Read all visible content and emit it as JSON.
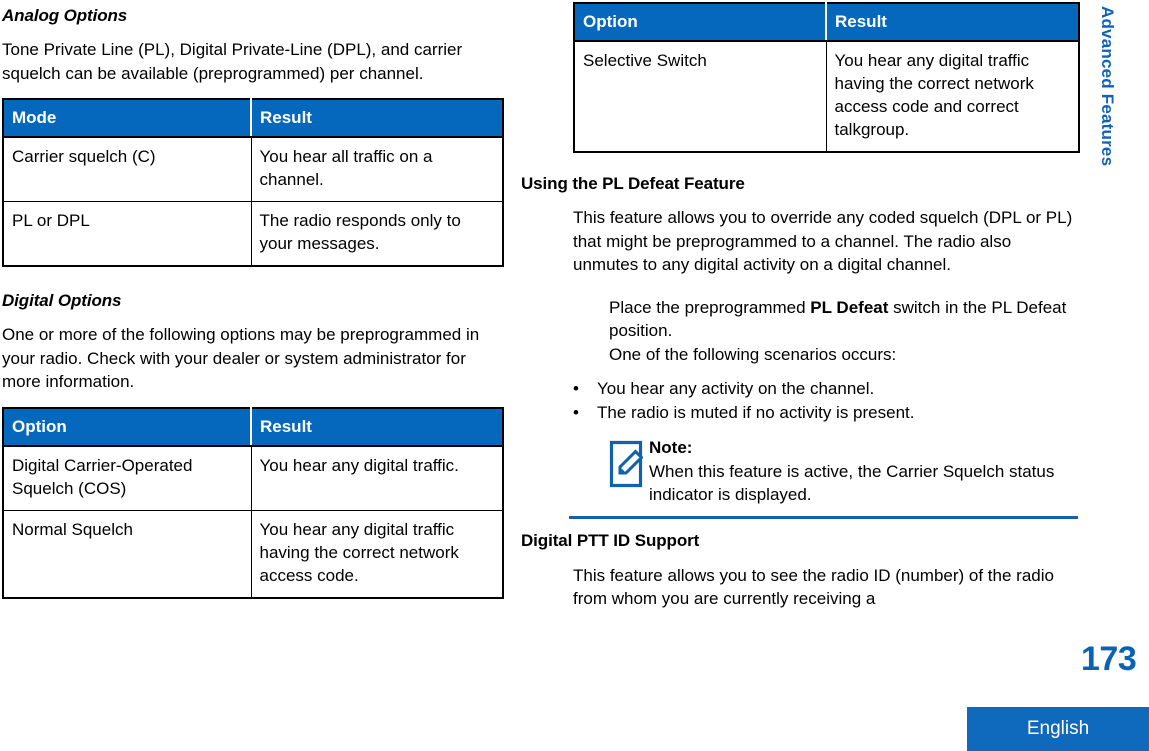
{
  "document": {
    "side_tab_label": "Advanced Features",
    "page_number": "173",
    "language_tab": "English",
    "accent_blue": "#0668bd",
    "rule_blue": "#0f62ab",
    "page_number_color": "#0a62b3"
  },
  "left_column": {
    "analog": {
      "heading": "Analog Options",
      "paragraph": "Tone Private Line (PL), Digital Private-Line (DPL), and carrier squelch can be available (preprogrammed) per channel.",
      "table": {
        "headers": [
          "Mode",
          "Result"
        ],
        "rows": [
          [
            "Carrier squelch (C)",
            "You hear all traffic on a channel."
          ],
          [
            "PL or DPL",
            "The radio responds only to your messages."
          ]
        ]
      }
    },
    "digital": {
      "heading": "Digital Options",
      "paragraph": "One or more of the following options may be preprogrammed in your radio. Check with your dealer or system administrator for more information.",
      "table": {
        "headers": [
          "Option",
          "Result"
        ],
        "rows": [
          [
            "Digital Carrier-Operated Squelch (COS)",
            "You hear any digital traffic."
          ],
          [
            "Normal Squelch",
            "You hear any digital traffic having the correct network access code."
          ]
        ]
      }
    }
  },
  "right_column": {
    "continued_table": {
      "headers": [
        "Option",
        "Result"
      ],
      "rows": [
        [
          "Selective Switch",
          "You hear any digital traffic having the correct network access code and correct talkgroup."
        ]
      ]
    },
    "pl_defeat": {
      "heading": "Using the PL Defeat Feature",
      "paragraph": "This feature allows you to override any coded squelch (DPL or PL) that might be preprogrammed to a channel. The radio also unmutes to any digital activity on a digital channel.",
      "step_prefix": "Place the preprogrammed ",
      "step_bold": "PL Defeat",
      "step_suffix": " switch in the PL Defeat position.",
      "scenarios_intro": "One of the following scenarios occurs:",
      "bullet_marker": "•",
      "bullets": [
        "You hear any activity on the channel.",
        "The radio is muted if no activity is present."
      ],
      "note": {
        "title": "Note:",
        "text": "When this feature is active, the Carrier Squelch status indicator is displayed.",
        "icon": "note-pencil-icon"
      }
    },
    "ptt_id": {
      "heading": "Digital PTT ID Support",
      "paragraph": "This feature allows you to see the radio ID (number) of the radio from whom you are currently receiving a"
    }
  }
}
